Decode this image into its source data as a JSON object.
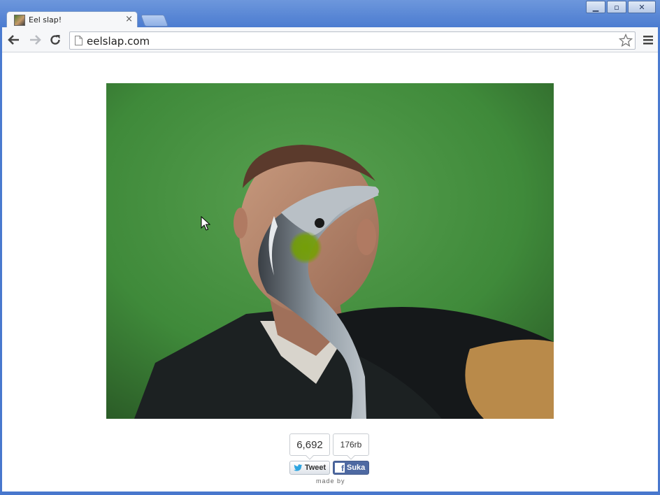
{
  "window": {
    "controls": {
      "minimize": "▁",
      "maximize": "▫",
      "close": "✕"
    }
  },
  "tab": {
    "title": "Eel slap!",
    "close": "×",
    "favicon": "eel-slap-favicon"
  },
  "toolbar": {
    "back_icon": "back-arrow-icon",
    "forward_icon": "forward-arrow-icon",
    "reload_icon": "reload-icon",
    "url": "eelslap.com",
    "bookmark_icon": "star-icon",
    "menu_icon": "menu-icon"
  },
  "page": {
    "video_alt": "man being slapped by eel",
    "tweet_count": "6,692",
    "fb_count": "176rb",
    "tweet_label": "Tweet",
    "fb_label": "Suka",
    "made_by": "made by"
  },
  "colors": {
    "chrome_frame": "#4a7bd0",
    "facebook_blue": "#4e69a2",
    "twitter_blue": "#2ea5e0",
    "green_screen": "#3f8a3a"
  }
}
